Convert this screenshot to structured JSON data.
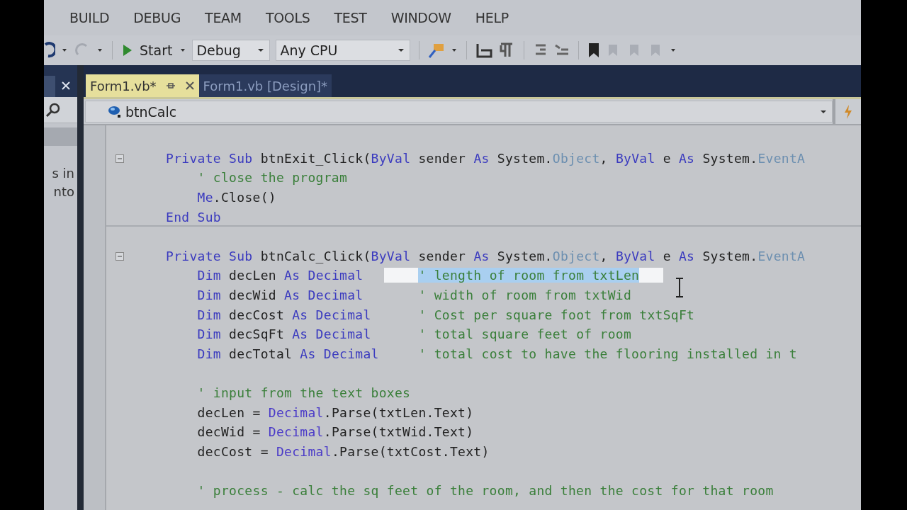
{
  "menu": [
    "BUILD",
    "DEBUG",
    "TEAM",
    "TOOLS",
    "TEST",
    "WINDOW",
    "HELP"
  ],
  "toolbar": {
    "start": "Start",
    "configuration": "Debug",
    "platform": "Any CPU"
  },
  "tabs": [
    {
      "label": "Form1.vb*",
      "selected": true
    },
    {
      "label": "Form1.vb [Design]*",
      "selected": false
    }
  ],
  "side_panel": {
    "lines": [
      "s in",
      "nto"
    ]
  },
  "navigation": {
    "member": "btnCalc"
  },
  "code": [
    {
      "kind": "blank"
    },
    {
      "kind": "code",
      "fold": true,
      "segments": [
        {
          "kind": "kw",
          "text": "Private Sub "
        },
        {
          "kind": "plain",
          "text": "btnExit_Click("
        },
        {
          "kind": "kw",
          "text": "ByVal"
        },
        {
          "kind": "plain",
          "text": " sender "
        },
        {
          "kind": "kw",
          "text": "As"
        },
        {
          "kind": "plain",
          "text": " System."
        },
        {
          "kind": "type",
          "text": "Object"
        },
        {
          "kind": "plain",
          "text": ", "
        },
        {
          "kind": "kw",
          "text": "ByVal"
        },
        {
          "kind": "plain",
          "text": " e "
        },
        {
          "kind": "kw",
          "text": "As"
        },
        {
          "kind": "plain",
          "text": " System."
        },
        {
          "kind": "type",
          "text": "EventA"
        }
      ]
    },
    {
      "kind": "code",
      "segments": [
        {
          "kind": "comment",
          "text": "    ' close the program"
        }
      ]
    },
    {
      "kind": "code",
      "segments": [
        {
          "kind": "kw",
          "text": "    Me"
        },
        {
          "kind": "plain",
          "text": ".Close()"
        }
      ]
    },
    {
      "kind": "code",
      "separator": true,
      "segments": [
        {
          "kind": "kw",
          "text": "End Sub"
        }
      ]
    },
    {
      "kind": "blank"
    },
    {
      "kind": "code",
      "fold": true,
      "segments": [
        {
          "kind": "kw",
          "text": "Private Sub "
        },
        {
          "kind": "plain",
          "text": "btnCalc_Click("
        },
        {
          "kind": "kw",
          "text": "ByVal"
        },
        {
          "kind": "plain",
          "text": " sender "
        },
        {
          "kind": "kw",
          "text": "As"
        },
        {
          "kind": "plain",
          "text": " System."
        },
        {
          "kind": "type",
          "text": "Object"
        },
        {
          "kind": "plain",
          "text": ", "
        },
        {
          "kind": "kw",
          "text": "ByVal"
        },
        {
          "kind": "plain",
          "text": " e "
        },
        {
          "kind": "kw",
          "text": "As"
        },
        {
          "kind": "plain",
          "text": " System."
        },
        {
          "kind": "type",
          "text": "EventA"
        }
      ]
    },
    {
      "kind": "code",
      "segments": [
        {
          "kind": "kw",
          "text": "    Dim"
        },
        {
          "kind": "plain",
          "text": " decLen "
        },
        {
          "kind": "kw",
          "text": "As Decimal       "
        },
        {
          "kind": "selected",
          "text": "' length of room from txtLen"
        }
      ]
    },
    {
      "kind": "code",
      "segments": [
        {
          "kind": "kw",
          "text": "    Dim"
        },
        {
          "kind": "plain",
          "text": " decWid "
        },
        {
          "kind": "kw",
          "text": "As Decimal       "
        },
        {
          "kind": "comment",
          "text": "' width of room from txtWid"
        }
      ]
    },
    {
      "kind": "code",
      "segments": [
        {
          "kind": "kw",
          "text": "    Dim"
        },
        {
          "kind": "plain",
          "text": " decCost "
        },
        {
          "kind": "kw",
          "text": "As Decimal      "
        },
        {
          "kind": "comment",
          "text": "' Cost per square foot from txtSqFt"
        }
      ]
    },
    {
      "kind": "code",
      "segments": [
        {
          "kind": "kw",
          "text": "    Dim"
        },
        {
          "kind": "plain",
          "text": " decSqFt "
        },
        {
          "kind": "kw",
          "text": "As Decimal      "
        },
        {
          "kind": "comment",
          "text": "' total square feet of room"
        }
      ]
    },
    {
      "kind": "code",
      "segments": [
        {
          "kind": "kw",
          "text": "    Dim"
        },
        {
          "kind": "plain",
          "text": " decTotal "
        },
        {
          "kind": "kw",
          "text": "As Decimal     "
        },
        {
          "kind": "comment",
          "text": "' total cost to have the flooring installed in t"
        }
      ]
    },
    {
      "kind": "blank"
    },
    {
      "kind": "code",
      "segments": [
        {
          "kind": "comment",
          "text": "    ' input from the text boxes"
        }
      ]
    },
    {
      "kind": "code",
      "segments": [
        {
          "kind": "plain",
          "text": "    decLen = "
        },
        {
          "kind": "type2",
          "text": "Decimal"
        },
        {
          "kind": "plain",
          "text": ".Parse(txtLen.Text)"
        }
      ]
    },
    {
      "kind": "code",
      "segments": [
        {
          "kind": "plain",
          "text": "    decWid = "
        },
        {
          "kind": "type2",
          "text": "Decimal"
        },
        {
          "kind": "plain",
          "text": ".Parse(txtWid.Text)"
        }
      ]
    },
    {
      "kind": "code",
      "segments": [
        {
          "kind": "plain",
          "text": "    decCost = "
        },
        {
          "kind": "type2",
          "text": "Decimal"
        },
        {
          "kind": "plain",
          "text": ".Parse(txtCost.Text)"
        }
      ]
    },
    {
      "kind": "blank"
    },
    {
      "kind": "code",
      "segments": [
        {
          "kind": "comment",
          "text": "    ' process - calc the sq feet of the room, and then the cost for that room"
        }
      ]
    }
  ]
}
